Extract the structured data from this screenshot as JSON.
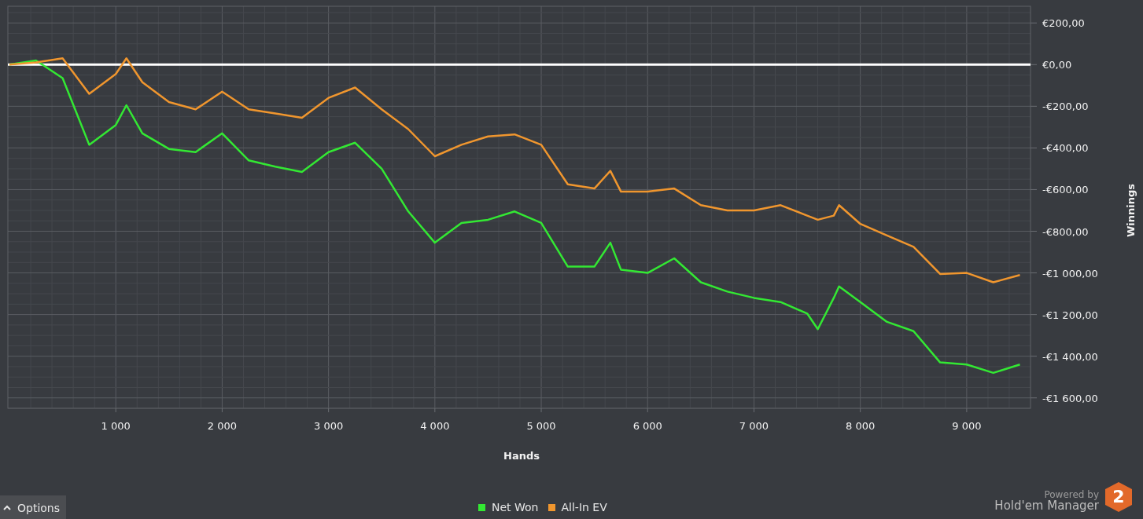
{
  "chart": {
    "chart_data": {
      "type": "line",
      "xlabel": "Hands",
      "ylabel": "Winnings",
      "x": [
        0,
        250,
        500,
        750,
        1000,
        1100,
        1250,
        1500,
        1750,
        2000,
        2250,
        2500,
        2750,
        3000,
        3250,
        3500,
        3750,
        4000,
        4250,
        4500,
        4750,
        5000,
        5250,
        5500,
        5650,
        5750,
        6000,
        6250,
        6500,
        6750,
        7000,
        7250,
        7500,
        7600,
        7750,
        7800,
        8000,
        8250,
        8500,
        8750,
        9000,
        9250,
        9500
      ],
      "series": [
        {
          "name": "Net Won",
          "color": "#33e833",
          "values": [
            0,
            20,
            -65,
            -385,
            -290,
            -195,
            -330,
            -405,
            -420,
            -330,
            -460,
            -490,
            -515,
            -420,
            -375,
            -500,
            -705,
            -855,
            -760,
            -745,
            -705,
            -760,
            -970,
            -970,
            -855,
            -985,
            -1000,
            -930,
            -1045,
            -1090,
            -1120,
            -1140,
            -1195,
            -1270,
            -1120,
            -1065,
            -1140,
            -1235,
            -1280,
            -1430,
            -1440,
            -1480,
            -1440
          ]
        },
        {
          "name": "All-In EV",
          "color": "#f0962e",
          "values": [
            0,
            10,
            30,
            -140,
            -45,
            30,
            -85,
            -180,
            -215,
            -130,
            -215,
            -235,
            -255,
            -160,
            -110,
            -215,
            -310,
            -440,
            -385,
            -345,
            -335,
            -385,
            -575,
            -595,
            -510,
            -610,
            -610,
            -595,
            -675,
            -700,
            -700,
            -675,
            -725,
            -745,
            -725,
            -675,
            -765,
            -820,
            -875,
            -1005,
            -1000,
            -1045,
            -1010
          ]
        }
      ],
      "xlim": [
        0,
        9600
      ],
      "ylim": [
        -1650,
        280
      ],
      "xticks": [
        {
          "value": 1000,
          "label": "1 000"
        },
        {
          "value": 2000,
          "label": "2 000"
        },
        {
          "value": 3000,
          "label": "3 000"
        },
        {
          "value": 4000,
          "label": "4 000"
        },
        {
          "value": 5000,
          "label": "5 000"
        },
        {
          "value": 6000,
          "label": "6 000"
        },
        {
          "value": 7000,
          "label": "7 000"
        },
        {
          "value": 8000,
          "label": "8 000"
        },
        {
          "value": 9000,
          "label": "9 000"
        }
      ],
      "yticks": [
        {
          "value": 200,
          "label": "€200,00"
        },
        {
          "value": 0,
          "label": "€0,00"
        },
        {
          "value": -200,
          "label": "-€200,00"
        },
        {
          "value": -400,
          "label": "-€400,00"
        },
        {
          "value": -600,
          "label": "-€600,00"
        },
        {
          "value": -800,
          "label": "-€800,00"
        },
        {
          "value": -1000,
          "label": "-€1 000,00"
        },
        {
          "value": -1200,
          "label": "-€1 200,00"
        },
        {
          "value": -1400,
          "label": "-€1 400,00"
        },
        {
          "value": -1600,
          "label": "-€1 600,00"
        }
      ],
      "grid": true,
      "ref_lines": [
        {
          "axis": "y",
          "value": 0
        }
      ]
    }
  },
  "options_button": {
    "label": "Options"
  },
  "branding": {
    "powered_by": "Powered by",
    "product": "Hold'em Manager",
    "logo_number": "2"
  }
}
